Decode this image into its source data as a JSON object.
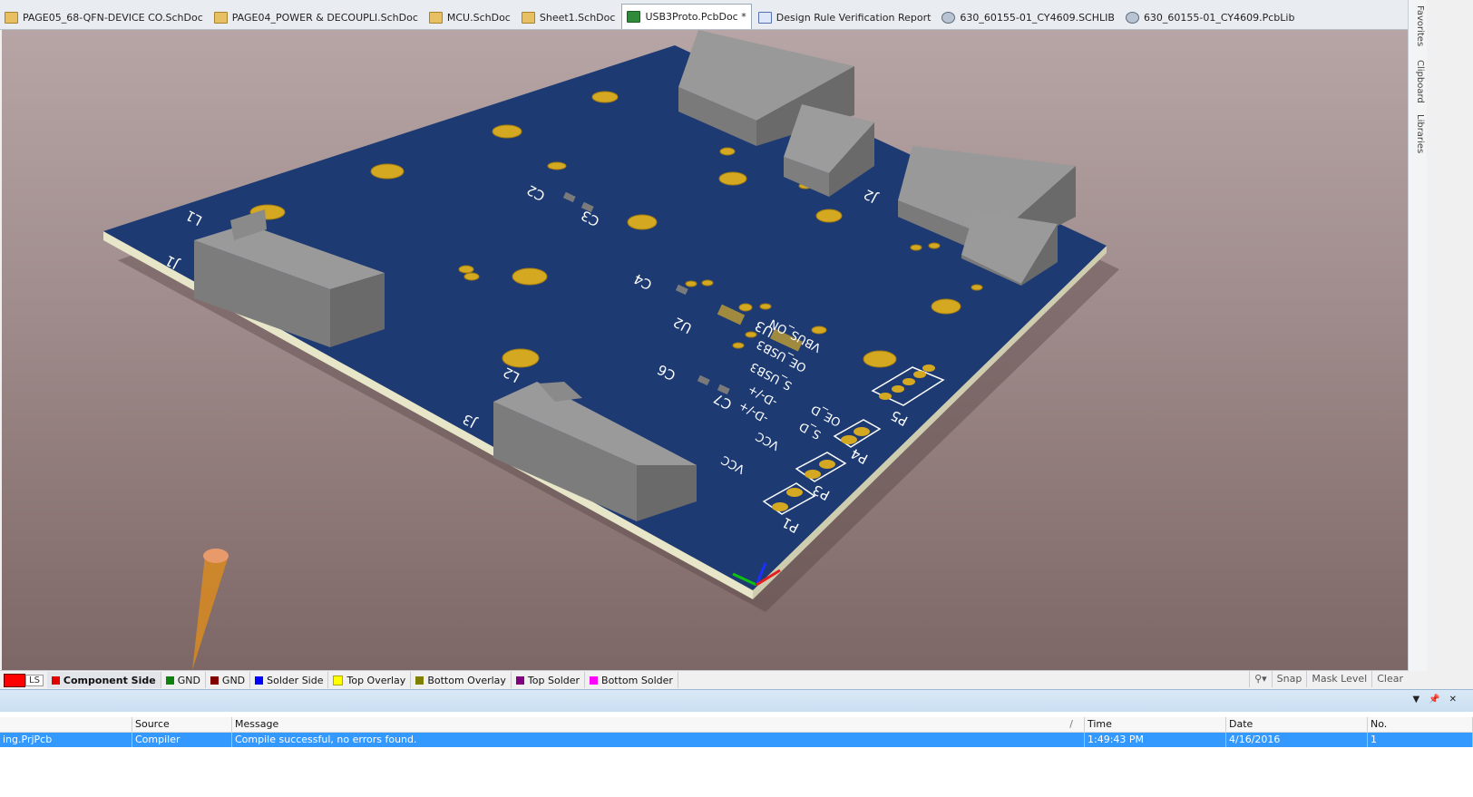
{
  "tabs": [
    {
      "label": "PAGE05_68-QFN-DEVICE CO.SchDoc",
      "icon": "schematic-doc-icon",
      "active": false
    },
    {
      "label": "PAGE04_POWER & DECOUPLI.SchDoc",
      "icon": "schematic-doc-icon",
      "active": false
    },
    {
      "label": "MCU.SchDoc",
      "icon": "schematic-doc-icon",
      "active": false
    },
    {
      "label": "Sheet1.SchDoc",
      "icon": "schematic-doc-icon",
      "active": false
    },
    {
      "label": "USB3Proto.PcbDoc *",
      "icon": "pcb-doc-icon",
      "active": true
    },
    {
      "label": "Design Rule Verification Report",
      "icon": "report-doc-icon",
      "active": false
    },
    {
      "label": "630_60155-01_CY4609.SCHLIB",
      "icon": "schlib-icon",
      "active": false
    },
    {
      "label": "630_60155-01_CY4609.PcbLib",
      "icon": "pcblib-icon",
      "active": false
    }
  ],
  "side_panels": [
    "Favorites",
    "Clipboard",
    "Libraries"
  ],
  "board": {
    "designators": [
      "J1",
      "J2",
      "J3",
      "L1",
      "L2",
      "C2",
      "C3",
      "C4",
      "C6",
      "C7",
      "U2",
      "U3",
      "P1",
      "P2",
      "P3",
      "P4",
      "P5"
    ],
    "silkscreen": [
      "VBUS_ON",
      "OE_USB3",
      "S_USB3",
      "-D-/+",
      "-D-/+",
      "S_D",
      "OE_D",
      "VCC",
      "VCC"
    ]
  },
  "layers": {
    "ls_label": "LS",
    "items": [
      {
        "label": "Component Side",
        "color": "#e00000",
        "active": true
      },
      {
        "label": "GND",
        "color": "#108010",
        "active": false
      },
      {
        "label": "GND",
        "color": "#800000",
        "active": false
      },
      {
        "label": "Solder Side",
        "color": "#0000ff",
        "active": false
      },
      {
        "label": "Top Overlay",
        "color": "#ffff00",
        "active": false
      },
      {
        "label": "Bottom Overlay",
        "color": "#808000",
        "active": false
      },
      {
        "label": "Top Solder",
        "color": "#800080",
        "active": false
      },
      {
        "label": "Bottom Solder",
        "color": "#ff00ff",
        "active": false
      }
    ],
    "right_buttons": [
      "Snap",
      "Mask Level",
      "Clear"
    ]
  },
  "messages": {
    "columns": [
      "",
      "Source",
      "Message",
      "Time",
      "Date",
      "No."
    ],
    "rows": [
      {
        "class": "ing.PrjPcb",
        "source": "Compiler",
        "message": "Compile successful, no errors found.",
        "time": "1:49:43 PM",
        "date": "4/16/2016",
        "no": "1"
      }
    ]
  },
  "colors": {
    "board": "#1d3a72",
    "pad": "#d4a820",
    "component": "#848484",
    "selection": "#3399ff"
  }
}
